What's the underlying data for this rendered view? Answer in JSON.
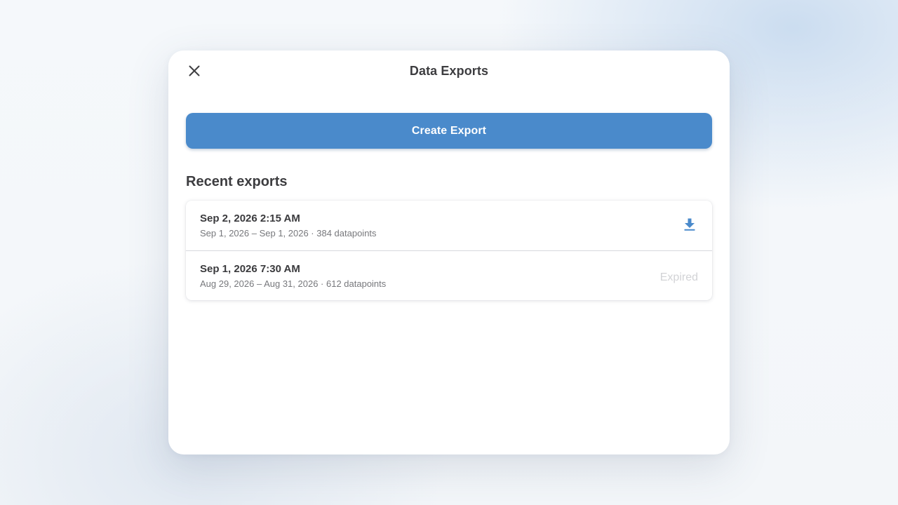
{
  "dialog": {
    "title": "Data Exports",
    "close_icon": "close-icon",
    "create_button_label": "Create Export",
    "recent_heading": "Recent exports"
  },
  "exports": [
    {
      "date": "Sep 2, 2026 2:15 AM",
      "details": "Sep 1, 2026 – Sep 1, 2026 · 384 datapoints",
      "action": "download",
      "action_icon": "download-icon"
    },
    {
      "date": "Sep 1, 2026 7:30 AM",
      "details": "Aug 29, 2026 – Aug 31, 2026 · 612 datapoints",
      "status": "Expired"
    }
  ],
  "colors": {
    "accent": "#4a8acb",
    "expired": "#d2d3d6"
  }
}
